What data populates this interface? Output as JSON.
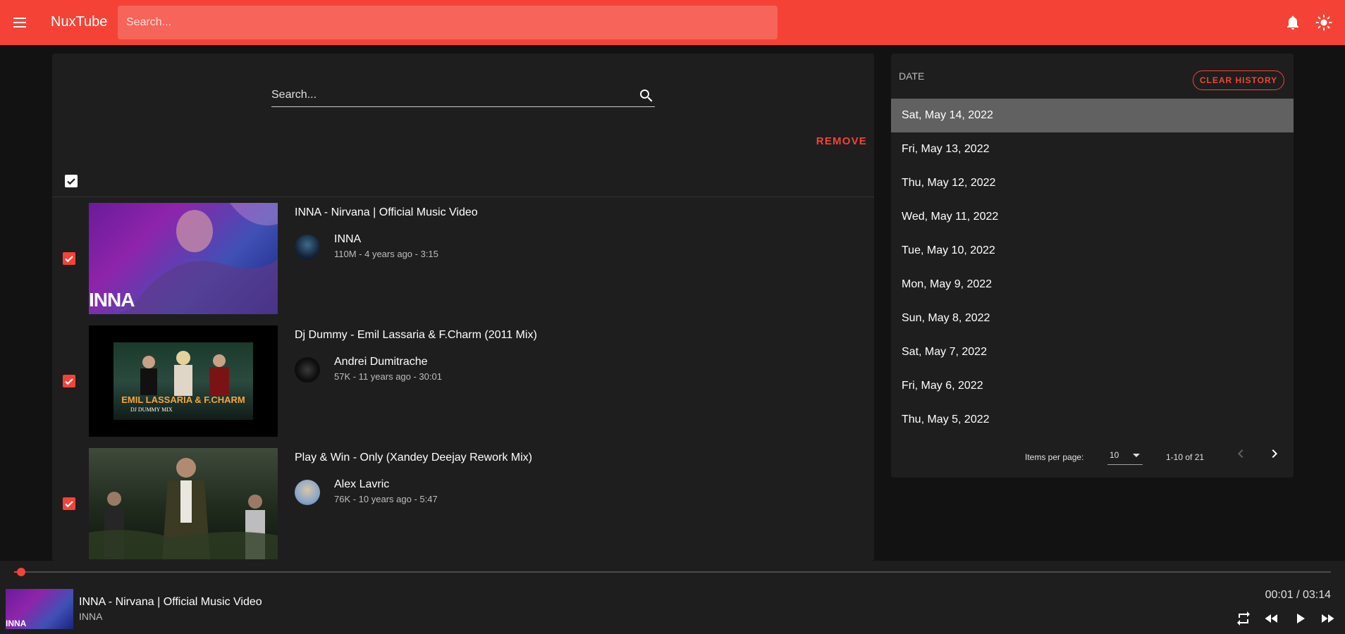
{
  "app": {
    "brand": "NuxTube",
    "search_placeholder": "Search...",
    "accent_color": "#f44336"
  },
  "history": {
    "search_placeholder": "Search...",
    "remove_label": "REMOVE",
    "select_all_checked": true,
    "videos": [
      {
        "title": "INNA - Nirvana | Official Music Video",
        "channel": "INNA",
        "meta": "110M - 4 years ago - 3:15",
        "thumb_text": "INNA",
        "checked": true
      },
      {
        "title": "Dj Dummy - Emil Lassaria & F.Charm (2011 Mix)",
        "channel": "Andrei Dumitrache",
        "meta": "57K - 11 years ago - 30:01",
        "thumb_text": "EMIL LASSARIA & F.CHARM",
        "thumb_subtext": "DJ DUMMY MIX",
        "checked": true
      },
      {
        "title": "Play & Win - Only (Xandey Deejay Rework Mix)",
        "channel": "Alex Lavric",
        "meta": "76K - 10 years ago - 5:47",
        "checked": true
      }
    ]
  },
  "dates": {
    "header": "DATE",
    "clear_label": "CLEAR HISTORY",
    "items": [
      "Sat, May 14, 2022",
      "Fri, May 13, 2022",
      "Thu, May 12, 2022",
      "Wed, May 11, 2022",
      "Tue, May 10, 2022",
      "Mon, May 9, 2022",
      "Sun, May 8, 2022",
      "Sat, May 7, 2022",
      "Fri, May 6, 2022",
      "Thu, May 5, 2022"
    ],
    "active_index": 0,
    "items_per_page_label": "Items per page:",
    "items_per_page": "10",
    "range": "1-10 of 21"
  },
  "player": {
    "title": "INNA - Nirvana | Official Music Video",
    "channel": "INNA",
    "time": "00:01 / 03:14",
    "progress_fraction": 0.0053,
    "thumb_text": "INNA"
  }
}
